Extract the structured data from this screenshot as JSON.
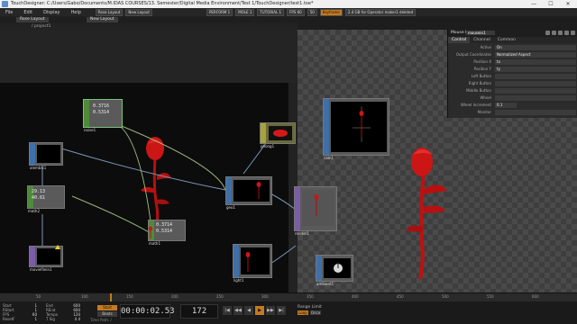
{
  "titlebar": {
    "title": "TouchDesigner: C:/Users/Gabo/Documents/M.IDAS COURSES/13. Semester/Digital Media Environment/Test 1/TouchDesigner/test1.toe*",
    "buttons": [
      "—",
      "☐",
      "✕"
    ]
  },
  "menubar": {
    "items": [
      "File",
      "Edit",
      "Display",
      "Help"
    ],
    "fields": [
      "Rose Layout",
      "New Layout",
      "PERFORM 1",
      "MOLE 1",
      "TUTORIAL 1",
      "FPS 60",
      "50",
      "Keyframe",
      "2.4 GB for Operator  maker1 deleted"
    ]
  },
  "network": {
    "tabs": [
      "Rose Layout",
      "New Layout"
    ],
    "path": "/ project1"
  },
  "operators": {
    "noise1": {
      "name": "noise1",
      "vals": [
        "0.3716",
        "0.5314"
      ]
    },
    "alembic1": {
      "name": "alembic1"
    },
    "math2": {
      "name": "math2",
      "vals": [
        "29.13",
        "40.61"
      ]
    },
    "moviefilein1": {
      "name": "moviefilein1"
    },
    "math1": {
      "name": "math1",
      "vals": [
        "0.3714",
        "0.5314"
      ]
    },
    "phong1": {
      "name": "phong1"
    },
    "geo1": {
      "name": "geo1"
    },
    "render1": {
      "name": "render1"
    },
    "cam1": {
      "name": "cam1"
    },
    "light1": {
      "name": "light1"
    },
    "ambient1": {
      "name": "ambient1"
    }
  },
  "panel": {
    "op_label": "Mouse In",
    "op_name": "mousein1",
    "tabs": [
      "Control",
      "Channel",
      "Common"
    ],
    "rows": [
      {
        "label": "Active",
        "value": "On"
      },
      {
        "label": "Output Coordinates",
        "value": "Normalized Aspect"
      },
      {
        "label": "Position X",
        "value": "tx"
      },
      {
        "label": "Position Y",
        "value": "ty"
      },
      {
        "label": "Left Button",
        "value": ""
      },
      {
        "label": "Right Button",
        "value": ""
      },
      {
        "label": "Middle Button",
        "value": ""
      },
      {
        "label": "Wheel",
        "value": ""
      },
      {
        "label": "Wheel Increment",
        "value": "0.1"
      },
      {
        "label": "Monitor",
        "value": ""
      }
    ]
  },
  "timeline": {
    "ticks": [
      "50",
      "100",
      "150",
      "200",
      "250",
      "300",
      "350",
      "400",
      "450",
      "500",
      "550",
      "600"
    ]
  },
  "bottom": {
    "perf": [
      [
        "Start",
        "1",
        "End",
        "600"
      ],
      [
        "RStart",
        "1",
        "REnd",
        "600"
      ],
      [
        "FPS",
        "60",
        "Tempo",
        "120"
      ],
      [
        "ResetF",
        "1",
        "T Sig",
        "4  4"
      ]
    ],
    "start_label": "Start",
    "end_label": "Beats",
    "timecode": "00:00:02.53",
    "frame": "172",
    "transport": [
      "|◀",
      "◀◀",
      "◀",
      "▶",
      "▶▶",
      "▶|"
    ],
    "range_label": "Range Limit",
    "range_buttons": [
      "Loop",
      "Once"
    ],
    "time_path": "Time Path: /"
  },
  "colors": {
    "accent": "#c47a1f",
    "rose": "#cc1515"
  }
}
